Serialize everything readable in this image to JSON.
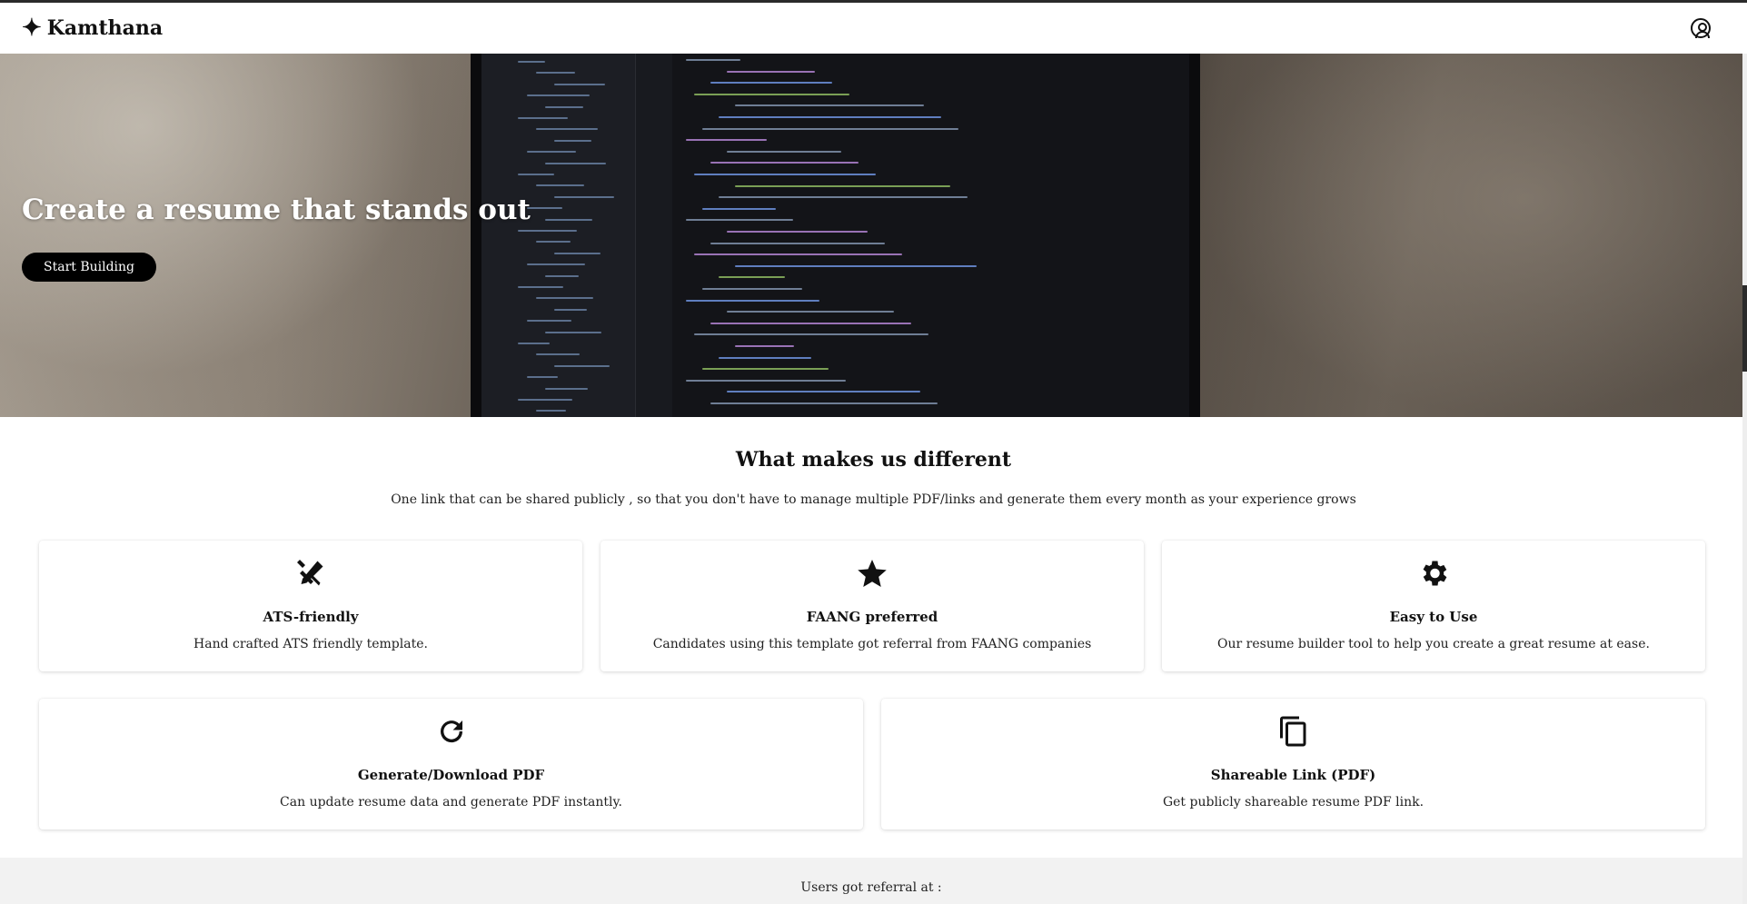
{
  "header": {
    "brand_name": "Kamthana",
    "brand_icon": "sparkle-icon",
    "account_icon": "account-circle-icon"
  },
  "hero": {
    "title": "Create a resume that stands out",
    "cta_label": "Start Building"
  },
  "features": {
    "title": "What makes us different",
    "subtitle": "One link that can be shared publicly , so that you don't have to manage multiple PDF/links and generate them every month as your experience grows",
    "cards": [
      {
        "icon": "design-tools-icon",
        "title": "ATS-friendly",
        "description": "Hand crafted ATS friendly template."
      },
      {
        "icon": "star-icon",
        "title": "FAANG preferred",
        "description": "Candidates using this template got referral from FAANG companies"
      },
      {
        "icon": "gear-icon",
        "title": "Easy to Use",
        "description": "Our resume builder tool to help you create a great resume at ease."
      },
      {
        "icon": "refresh-icon",
        "title": "Generate/Download PDF",
        "description": "Can update resume data and generate PDF instantly."
      },
      {
        "icon": "copy-icon",
        "title": "Shareable Link (PDF)",
        "description": "Get publicly shareable resume PDF link."
      }
    ]
  },
  "footer": {
    "referral_text": "Users got referral at :"
  }
}
